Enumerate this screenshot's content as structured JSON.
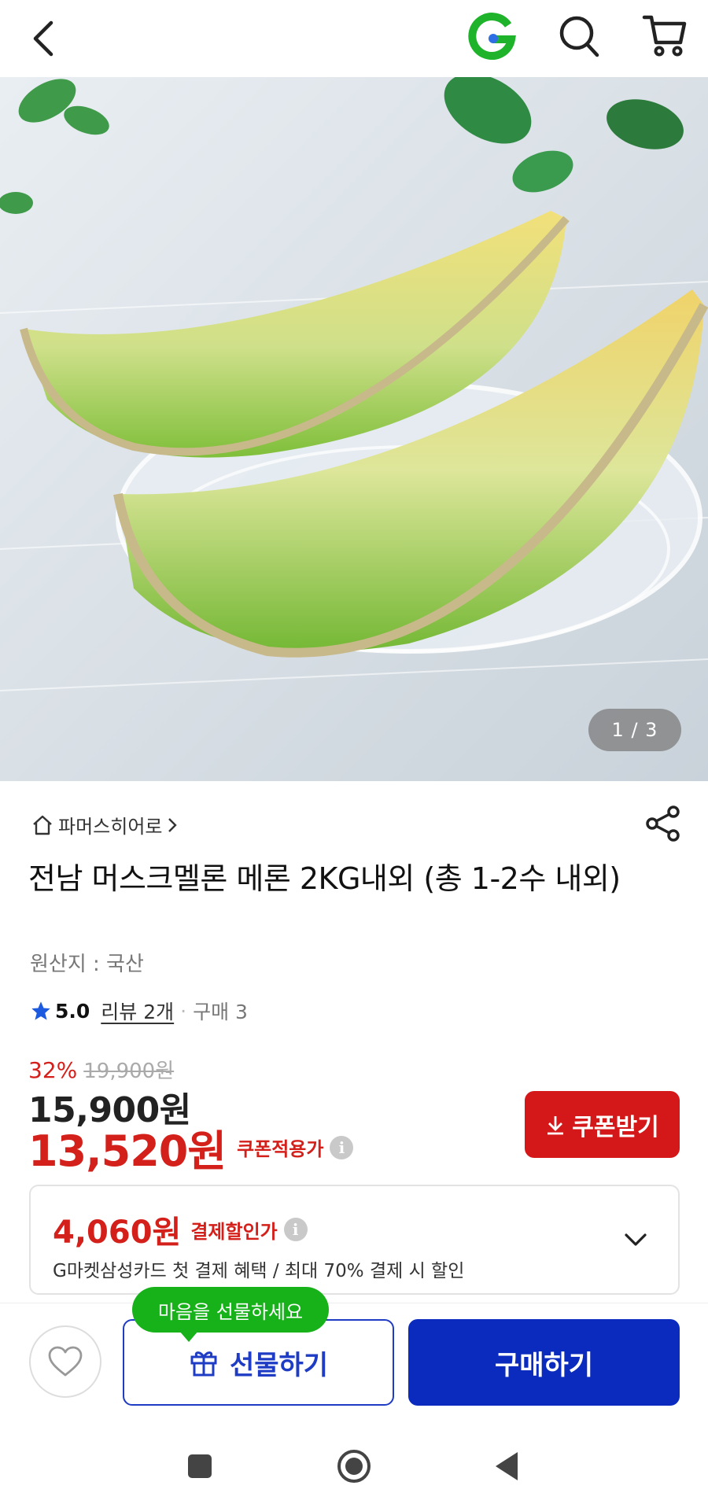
{
  "topbar": {
    "back_icon": "chevron-left-icon",
    "logo_icon": "g-logo-icon",
    "search_icon": "search-icon",
    "cart_icon": "cart-icon"
  },
  "hero": {
    "pager": "1 / 3"
  },
  "product": {
    "seller": "파머스히어로",
    "title": "전남 머스크멜론 메론 2KG내외 (총 1-2수 내외)",
    "origin": "원산지 : 국산",
    "rating": "5.0",
    "reviews": "리뷰 2개",
    "purchases": "구매 3"
  },
  "pricing": {
    "discount_pct": "32%",
    "original_price": "19,900원",
    "price": "15,900원",
    "coupon_price": "13,520원",
    "coupon_label": "쿠폰적용가",
    "coupon_button": "쿠폰받기"
  },
  "payment": {
    "amount": "4,060원",
    "label": "결제할인가",
    "description": "G마켓삼성카드 첫 결제 혜택 / 최대 70% 결제 시 할인"
  },
  "actions": {
    "tooltip": "마음을 선물하세요",
    "gift": "선물하기",
    "buy": "구매하기"
  },
  "colors": {
    "accent_red": "#d4181a",
    "accent_blue": "#0a2bbd",
    "accent_green": "#17b21a"
  }
}
